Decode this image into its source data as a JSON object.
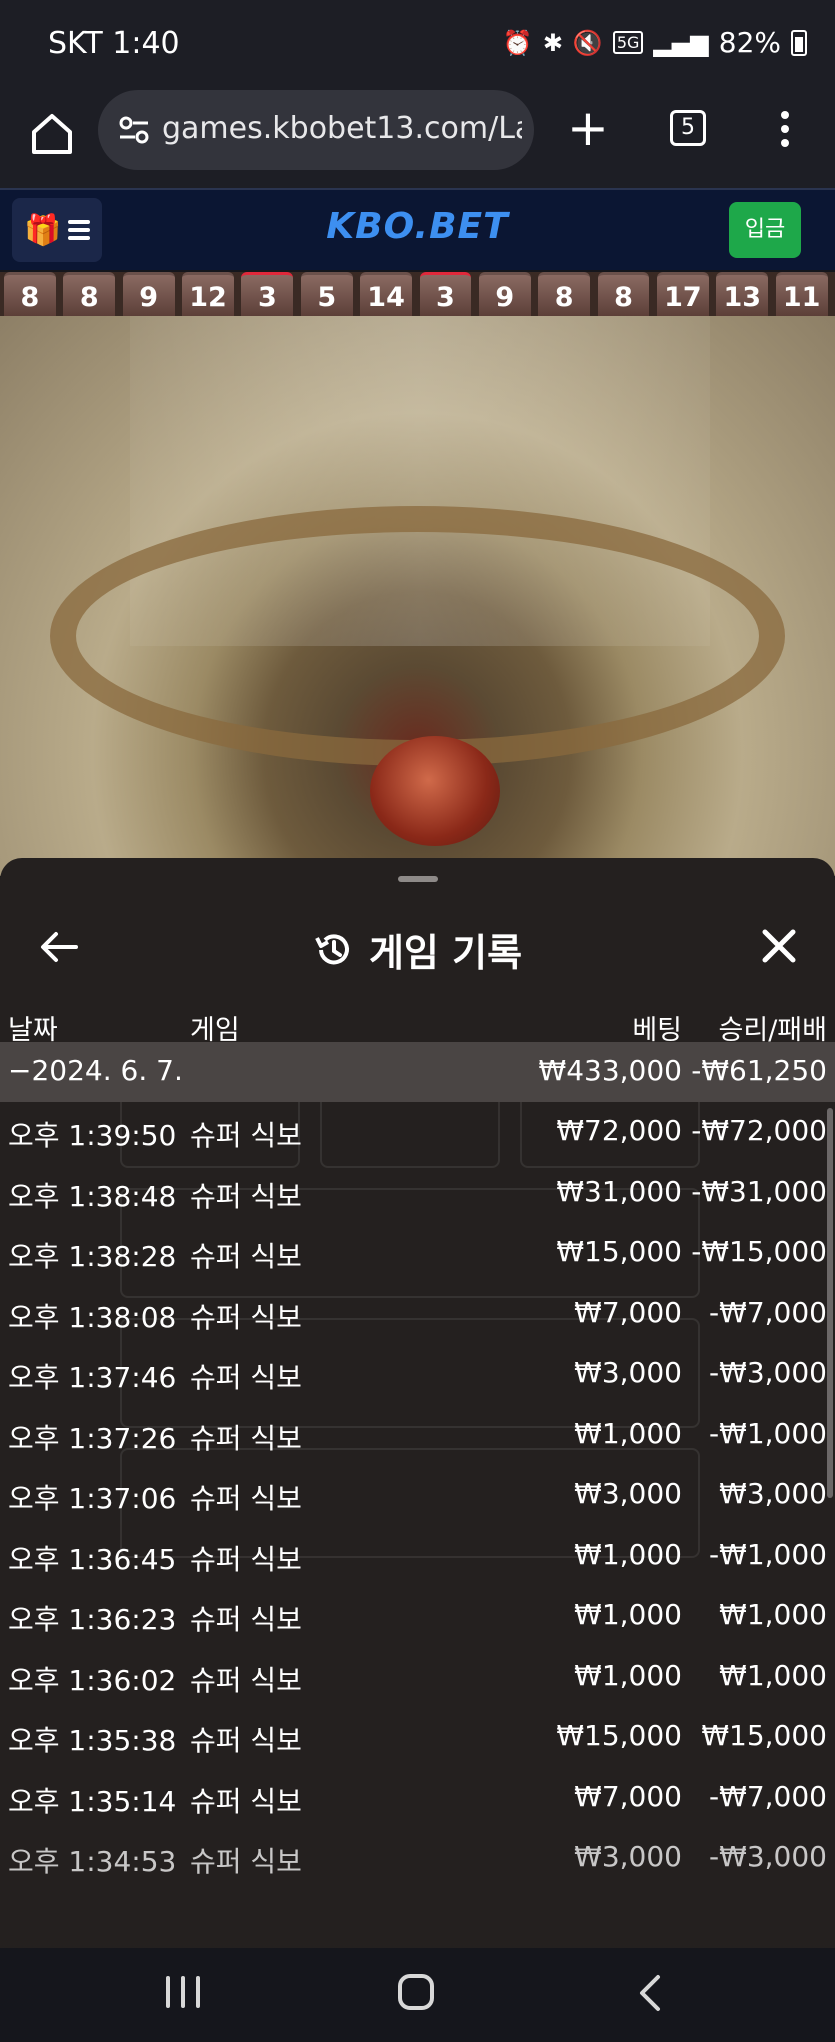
{
  "status_bar": {
    "carrier_time": "SKT 1:40",
    "battery": "82%",
    "icons": [
      "alarm-icon",
      "bluetooth-icon",
      "mute-icon",
      "5g-icon",
      "signal-icon",
      "battery-icon"
    ]
  },
  "browser": {
    "url": "games.kbobet13.com/Lau",
    "tab_count": "5"
  },
  "site": {
    "logo": "KBO.BET",
    "deposit_label": "입금"
  },
  "results": [
    {
      "v": "8",
      "red": false
    },
    {
      "v": "8",
      "red": false
    },
    {
      "v": "9",
      "red": false
    },
    {
      "v": "12",
      "red": false
    },
    {
      "v": "3",
      "red": true
    },
    {
      "v": "5",
      "red": false
    },
    {
      "v": "14",
      "red": false
    },
    {
      "v": "3",
      "red": true
    },
    {
      "v": "9",
      "red": false
    },
    {
      "v": "8",
      "red": false
    },
    {
      "v": "8",
      "red": false
    },
    {
      "v": "17",
      "red": false
    },
    {
      "v": "13",
      "red": false
    },
    {
      "v": "11",
      "red": false
    }
  ],
  "sheet": {
    "title": "게임 기록",
    "columns": {
      "date": "날짜",
      "game": "게임",
      "bet": "베팅",
      "result": "승리/패배"
    },
    "summary": {
      "date": "−2024. 6. 7.",
      "game": "",
      "bet": "₩433,000",
      "result": "-₩61,250"
    },
    "rows": [
      {
        "date": "오후 1:39:50",
        "game": "슈퍼 식보",
        "bet": "₩72,000",
        "result": "-₩72,000"
      },
      {
        "date": "오후 1:38:48",
        "game": "슈퍼 식보",
        "bet": "₩31,000",
        "result": "-₩31,000"
      },
      {
        "date": "오후 1:38:28",
        "game": "슈퍼 식보",
        "bet": "₩15,000",
        "result": "-₩15,000"
      },
      {
        "date": "오후 1:38:08",
        "game": "슈퍼 식보",
        "bet": "₩7,000",
        "result": "-₩7,000"
      },
      {
        "date": "오후 1:37:46",
        "game": "슈퍼 식보",
        "bet": "₩3,000",
        "result": "-₩3,000"
      },
      {
        "date": "오후 1:37:26",
        "game": "슈퍼 식보",
        "bet": "₩1,000",
        "result": "-₩1,000"
      },
      {
        "date": "오후 1:37:06",
        "game": "슈퍼 식보",
        "bet": "₩3,000",
        "result": "₩3,000"
      },
      {
        "date": "오후 1:36:45",
        "game": "슈퍼 식보",
        "bet": "₩1,000",
        "result": "-₩1,000"
      },
      {
        "date": "오후 1:36:23",
        "game": "슈퍼 식보",
        "bet": "₩1,000",
        "result": "₩1,000"
      },
      {
        "date": "오후 1:36:02",
        "game": "슈퍼 식보",
        "bet": "₩1,000",
        "result": "₩1,000"
      },
      {
        "date": "오후 1:35:38",
        "game": "슈퍼 식보",
        "bet": "₩15,000",
        "result": "₩15,000"
      },
      {
        "date": "오후 1:35:14",
        "game": "슈퍼 식보",
        "bet": "₩7,000",
        "result": "-₩7,000"
      },
      {
        "date": "오후 1:34:53",
        "game": "슈퍼 식보",
        "bet": "₩3,000",
        "result": "-₩3,000"
      }
    ]
  }
}
